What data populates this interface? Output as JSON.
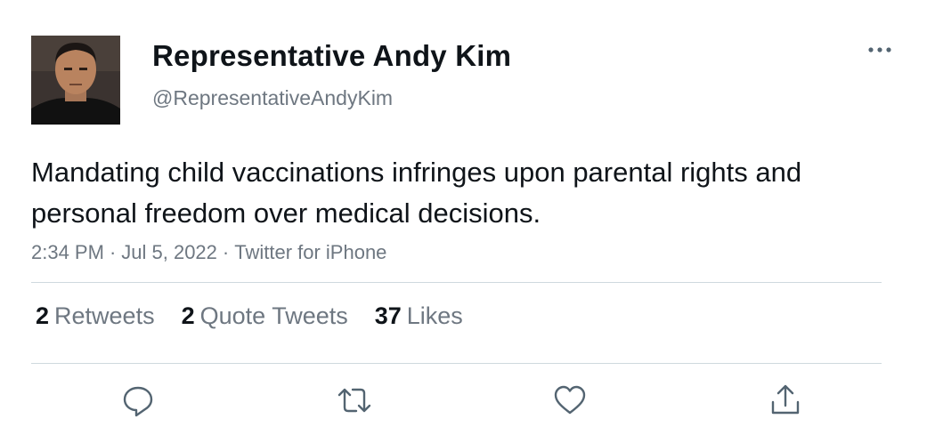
{
  "tweet": {
    "display_name": "Representative Andy Kim",
    "handle": "@RepresentativeAndyKim",
    "text": "Mandating child vaccinations infringes upon parental rights and personal freedom over medical decisions.",
    "time": "2:34 PM",
    "date": "Jul 5, 2022",
    "source": "Twitter for iPhone",
    "separator": "·"
  },
  "stats": {
    "retweets": {
      "count": "2",
      "label": "Retweets"
    },
    "quotes": {
      "count": "2",
      "label": "Quote Tweets"
    },
    "likes": {
      "count": "37",
      "label": "Likes"
    }
  },
  "icons": {
    "more": "more-dots-icon",
    "reply": "reply-icon",
    "retweet": "retweet-icon",
    "like": "like-icon",
    "share": "share-icon"
  },
  "colors": {
    "text_primary": "#0f1419",
    "text_secondary": "#6e7781",
    "divider": "#cfd9de",
    "icon": "#536471"
  }
}
